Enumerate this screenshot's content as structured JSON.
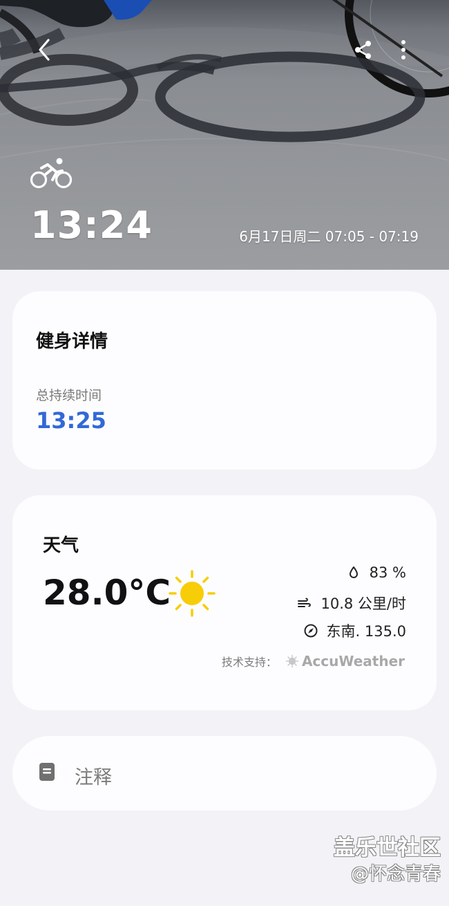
{
  "hero": {
    "activity_icon": "cycling-icon",
    "duration": "13:24",
    "date_range": "6月17日周二 07:05 - 07:19",
    "back_icon": "back-arrow-icon",
    "share_icon": "share-icon",
    "more_icon": "more-vert-icon"
  },
  "fitness": {
    "title": "健身详情",
    "total_duration_label": "总持续时间",
    "total_duration_value": "13:25"
  },
  "weather": {
    "title": "天气",
    "temperature": "28.0°C",
    "condition_icon": "sun-icon",
    "humidity": "83 %",
    "wind_speed": "10.8 公里/时",
    "wind_direction": "东南. 135.0",
    "powered_by_label": "技术支持：",
    "provider": "AccuWeather"
  },
  "notes": {
    "label": "注释",
    "icon": "note-icon"
  },
  "watermark": {
    "title": "盖乐世社区",
    "subtitle": "@怀念青春"
  },
  "colors": {
    "accent_blue": "#3169d6",
    "page_background": "#f2f2f7",
    "card_background": "#fdfdff",
    "sun_yellow": "#f7cd08"
  }
}
